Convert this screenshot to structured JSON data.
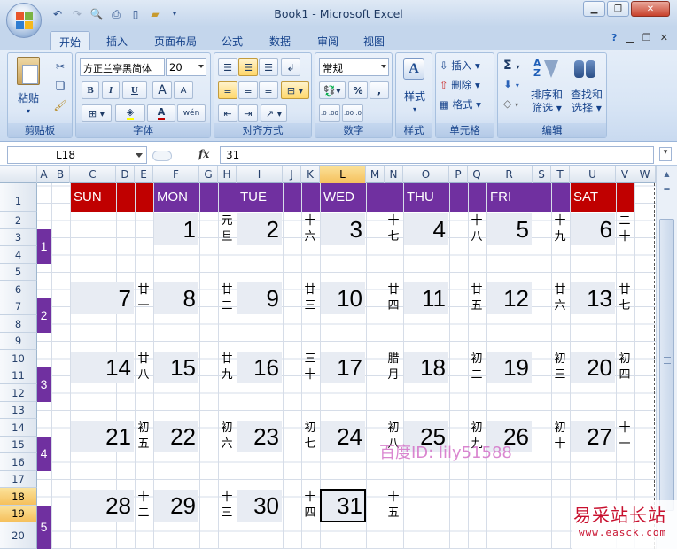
{
  "window": {
    "title": "Book1 - Microsoft Excel"
  },
  "tabs": [
    "开始",
    "插入",
    "页面布局",
    "公式",
    "数据",
    "审阅",
    "视图"
  ],
  "ribbon": {
    "clipboard": {
      "label": "剪贴板",
      "paste": "粘贴"
    },
    "font": {
      "label": "字体",
      "name": "方正兰亭黑简体",
      "size": "20",
      "bold": "B",
      "italic": "I",
      "underline": "U",
      "grow": "A",
      "shrink": "A",
      "phonetic": "wén"
    },
    "alignment": {
      "label": "对齐方式"
    },
    "number": {
      "label": "数字",
      "format": "常规",
      "percent": "%",
      "comma": ",",
      "inc_decimal": ".0 .00",
      "dec_decimal": ".00 .0"
    },
    "styles": {
      "label": "样式"
    },
    "cells": {
      "label": "单元格",
      "insert": "插入",
      "delete": "删除",
      "format": "格式"
    },
    "editing": {
      "label": "编辑",
      "sort": "排序和",
      "sort2": "筛选",
      "find": "查找和",
      "find2": "选择",
      "sigma": "Σ"
    }
  },
  "formula_bar": {
    "name_box": "L18",
    "fx": "fx",
    "value": "31"
  },
  "columns": [
    "A",
    "B",
    "C",
    "D",
    "E",
    "F",
    "G",
    "H",
    "I",
    "J",
    "K",
    "L",
    "M",
    "N",
    "O",
    "P",
    "Q",
    "R",
    "S",
    "T",
    "U",
    "V",
    "W"
  ],
  "rows": [
    "1",
    "2",
    "3",
    "4",
    "5",
    "6",
    "7",
    "8",
    "9",
    "10",
    "11",
    "12",
    "13",
    "14",
    "15",
    "16",
    "17",
    "18",
    "19",
    "20"
  ],
  "calendar": {
    "day_headers": [
      "SUN",
      "MON",
      "TUE",
      "WED",
      "THU",
      "FRI",
      "SAT"
    ],
    "week_numbers": [
      "1",
      "2",
      "3",
      "4",
      "5"
    ],
    "weeks": [
      [
        null,
        null,
        null,
        null,
        null,
        null,
        null
      ],
      [
        {
          "d": "7",
          "l": [
            "廿",
            "一"
          ]
        },
        {
          "d": "8",
          "l": [
            "廿",
            "二"
          ]
        },
        {
          "d": "9",
          "l": [
            "廿",
            "三"
          ]
        },
        {
          "d": "10",
          "l": [
            "廿",
            "四"
          ]
        },
        {
          "d": "11",
          "l": [
            "廿",
            "五"
          ]
        },
        {
          "d": "12",
          "l": [
            "廿",
            "六"
          ]
        },
        {
          "d": "13",
          "l": [
            "廿",
            "七"
          ]
        }
      ],
      [
        {
          "d": "14",
          "l": [
            "廿",
            "八"
          ]
        },
        {
          "d": "15",
          "l": [
            "廿",
            "九"
          ]
        },
        {
          "d": "16",
          "l": [
            "三",
            "十"
          ]
        },
        {
          "d": "17",
          "l": [
            "腊",
            "月"
          ]
        },
        {
          "d": "18",
          "l": [
            "初",
            "二"
          ]
        },
        {
          "d": "19",
          "l": [
            "初",
            "三"
          ]
        },
        {
          "d": "20",
          "l": [
            "初",
            "四"
          ]
        }
      ],
      [
        {
          "d": "21",
          "l": [
            "初",
            "五"
          ]
        },
        {
          "d": "22",
          "l": [
            "初",
            "六"
          ]
        },
        {
          "d": "23",
          "l": [
            "初",
            "七"
          ]
        },
        {
          "d": "24",
          "l": [
            "初",
            "八"
          ]
        },
        {
          "d": "25",
          "l": [
            "初",
            "九"
          ]
        },
        {
          "d": "26",
          "l": [
            "初",
            "十"
          ]
        },
        {
          "d": "27",
          "l": [
            "十",
            "一"
          ]
        }
      ],
      [
        {
          "d": "28",
          "l": [
            "十",
            "二"
          ]
        },
        {
          "d": "29",
          "l": [
            "十",
            "三"
          ]
        },
        {
          "d": "30",
          "l": [
            "十",
            "四"
          ]
        },
        {
          "d": "31",
          "l": [
            "十",
            "五"
          ]
        },
        null,
        null,
        null
      ]
    ],
    "first_week": [
      null,
      {
        "d": "1",
        "l": [
          "元",
          "旦"
        ]
      },
      {
        "d": "2",
        "l": [
          "十",
          "六"
        ]
      },
      {
        "d": "3",
        "l": [
          "十",
          "七"
        ]
      },
      {
        "d": "4",
        "l": [
          "十",
          "八"
        ]
      },
      {
        "d": "5",
        "l": [
          "十",
          "九"
        ]
      },
      {
        "d": "6",
        "l": [
          "二",
          "十"
        ]
      }
    ]
  },
  "colors": {
    "sun": "#c00000",
    "weekday": "#7030a0",
    "sat": "#c00000"
  },
  "watermark": "百度ID: lily51588",
  "site_logo": {
    "name": "易采站长站",
    "url": "www.easck.com"
  }
}
